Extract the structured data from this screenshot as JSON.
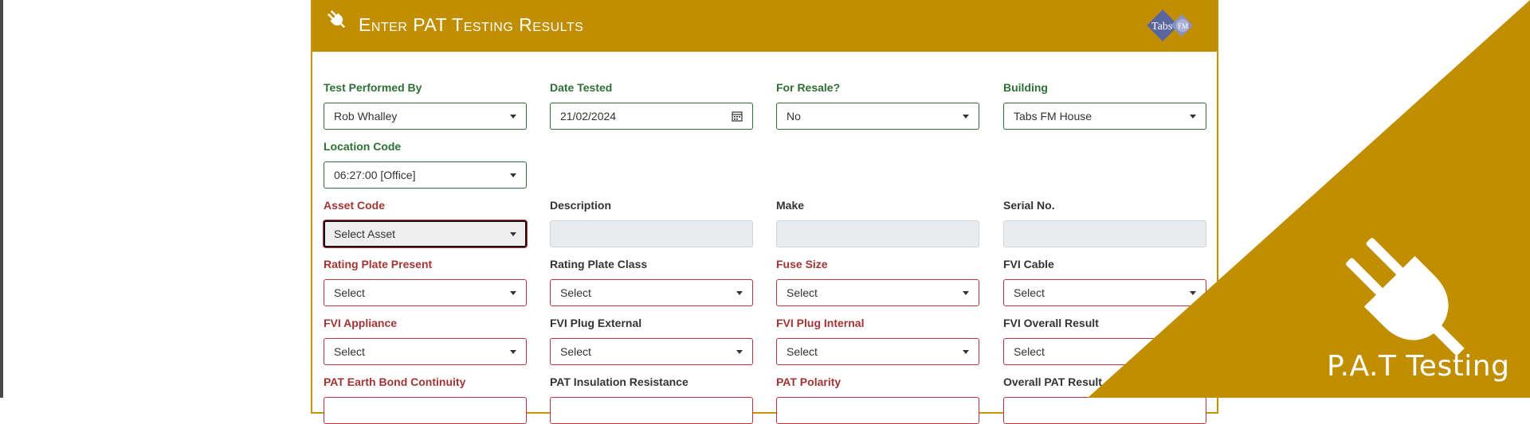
{
  "header": {
    "title": "Enter PAT Testing Results",
    "icon": "plug-icon",
    "logo_text": "Tabs",
    "logo_mark": "FM"
  },
  "form": {
    "test_performed_by": {
      "label": "Test Performed By",
      "value": "Rob Whalley"
    },
    "date_tested": {
      "label": "Date Tested",
      "value": "21/02/2024"
    },
    "for_resale": {
      "label": "For Resale?",
      "value": "No"
    },
    "building": {
      "label": "Building",
      "value": "Tabs FM House"
    },
    "location_code": {
      "label": "Location Code",
      "value": "06:27:00 [Office]"
    },
    "asset_code": {
      "label": "Asset Code",
      "value": "Select Asset"
    },
    "description": {
      "label": "Description",
      "value": ""
    },
    "make": {
      "label": "Make",
      "value": ""
    },
    "serial_no": {
      "label": "Serial No.",
      "value": ""
    },
    "rating_plate_present": {
      "label": "Rating Plate Present",
      "value": "Select"
    },
    "rating_plate_class": {
      "label": "Rating Plate Class",
      "value": "Select"
    },
    "fuse_size": {
      "label": "Fuse Size",
      "value": "Select"
    },
    "fvi_cable": {
      "label": "FVI Cable",
      "value": "Select"
    },
    "fvi_appliance": {
      "label": "FVI Appliance",
      "value": "Select"
    },
    "fvi_plug_external": {
      "label": "FVI Plug External",
      "value": "Select"
    },
    "fvi_plug_internal": {
      "label": "FVI Plug Internal",
      "value": "Select"
    },
    "fvi_overall_result": {
      "label": "FVI Overall Result",
      "value": "Select"
    },
    "pat_earth_bond_continuity": {
      "label": "PAT Earth Bond Continuity"
    },
    "pat_insulation_resistance": {
      "label": "PAT Insulation Resistance"
    },
    "pat_polarity": {
      "label": "PAT Polarity"
    },
    "overall_pat_result": {
      "label": "Overall PAT Result"
    }
  },
  "promo": {
    "text": "P.A.T Testing",
    "icon": "plug-icon"
  },
  "colors": {
    "accent": "#c18e00",
    "valid_green": "#2e6f34",
    "required_red": "#a33434",
    "left_edge": "#4a4a4a"
  }
}
